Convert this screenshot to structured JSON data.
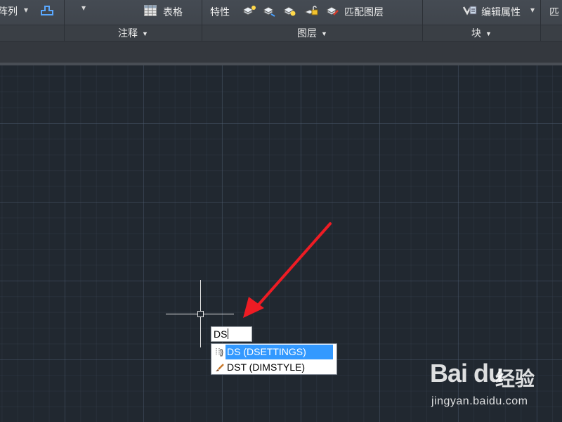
{
  "ribbon": {
    "panels": [
      {
        "title": ""
      },
      {
        "title": "注释"
      },
      {
        "title": "图层"
      },
      {
        "title": "块"
      }
    ],
    "modify": {
      "array_label": "阵列"
    },
    "annotation": {
      "table_label": "表格"
    },
    "layers": {
      "properties_label": "特性",
      "match_layer_label": "匹配图层"
    },
    "block": {
      "edit_attributes_label": "编辑属性",
      "match_clip": "匹"
    }
  },
  "command": {
    "input_value": "DS",
    "suggestions": [
      {
        "label": "DS (DSETTINGS)",
        "icon": "drafting-settings-icon",
        "selected": true
      },
      {
        "label": "DST (DIMSTYLE)",
        "icon": "dimstyle-brush-icon",
        "selected": false
      }
    ]
  },
  "annotation_arrow": {
    "color": "#ee1c24"
  },
  "watermark": {
    "logo": "Bai du",
    "cn": "经验",
    "url": "jingyan.baidu.com"
  },
  "colors": {
    "canvas": "#212830",
    "ribbon": "#3c4148",
    "selection": "#3399ff"
  }
}
